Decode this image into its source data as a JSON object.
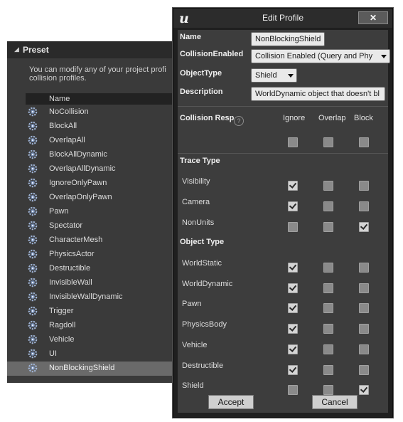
{
  "preset": {
    "title": "Preset",
    "description_line1": "You can modify any of your project profi",
    "description_line2": "collision profiles.",
    "column_name": "Name",
    "items": [
      {
        "label": "NoCollision",
        "selected": false
      },
      {
        "label": "BlockAll",
        "selected": false
      },
      {
        "label": "OverlapAll",
        "selected": false
      },
      {
        "label": "BlockAllDynamic",
        "selected": false
      },
      {
        "label": "OverlapAllDynamic",
        "selected": false
      },
      {
        "label": "IgnoreOnlyPawn",
        "selected": false
      },
      {
        "label": "OverlapOnlyPawn",
        "selected": false
      },
      {
        "label": "Pawn",
        "selected": false
      },
      {
        "label": "Spectator",
        "selected": false
      },
      {
        "label": "CharacterMesh",
        "selected": false
      },
      {
        "label": "PhysicsActor",
        "selected": false
      },
      {
        "label": "Destructible",
        "selected": false
      },
      {
        "label": "InvisibleWall",
        "selected": false
      },
      {
        "label": "InvisibleWallDynamic",
        "selected": false
      },
      {
        "label": "Trigger",
        "selected": false
      },
      {
        "label": "Ragdoll",
        "selected": false
      },
      {
        "label": "Vehicle",
        "selected": false
      },
      {
        "label": "UI",
        "selected": false
      },
      {
        "label": "NonBlockingShield",
        "selected": true
      }
    ]
  },
  "dialog": {
    "title": "Edit Profile",
    "close_label": "✕",
    "fields": {
      "name_label": "Name",
      "name_value": "NonBlockingShield",
      "collision_enabled_label": "CollisionEnabled",
      "collision_enabled_value": "Collision Enabled (Query and Phy",
      "object_type_label": "ObjectType",
      "object_type_value": "Shield",
      "description_label": "Description",
      "description_value": "WorldDynamic object that doesn't bl"
    },
    "columns": {
      "collision_response_label": "Collision Respo",
      "ignore": "Ignore",
      "overlap": "Overlap",
      "block": "Block"
    },
    "all_row": {
      "ignore": false,
      "overlap": false,
      "block": false
    },
    "trace_type": {
      "title": "Trace Type",
      "rows": [
        {
          "label": "Visibility",
          "ignore": true,
          "overlap": false,
          "block": false
        },
        {
          "label": "Camera",
          "ignore": true,
          "overlap": false,
          "block": false
        },
        {
          "label": "NonUnits",
          "ignore": false,
          "overlap": false,
          "block": true
        }
      ]
    },
    "object_type": {
      "title": "Object Type",
      "rows": [
        {
          "label": "WorldStatic",
          "ignore": true,
          "overlap": false,
          "block": false
        },
        {
          "label": "WorldDynamic",
          "ignore": true,
          "overlap": false,
          "block": false
        },
        {
          "label": "Pawn",
          "ignore": true,
          "overlap": false,
          "block": false
        },
        {
          "label": "PhysicsBody",
          "ignore": true,
          "overlap": false,
          "block": false
        },
        {
          "label": "Vehicle",
          "ignore": true,
          "overlap": false,
          "block": false
        },
        {
          "label": "Destructible",
          "ignore": true,
          "overlap": false,
          "block": false
        },
        {
          "label": "Shield",
          "ignore": false,
          "overlap": false,
          "block": true
        }
      ]
    },
    "accept_label": "Accept",
    "cancel_label": "Cancel"
  }
}
